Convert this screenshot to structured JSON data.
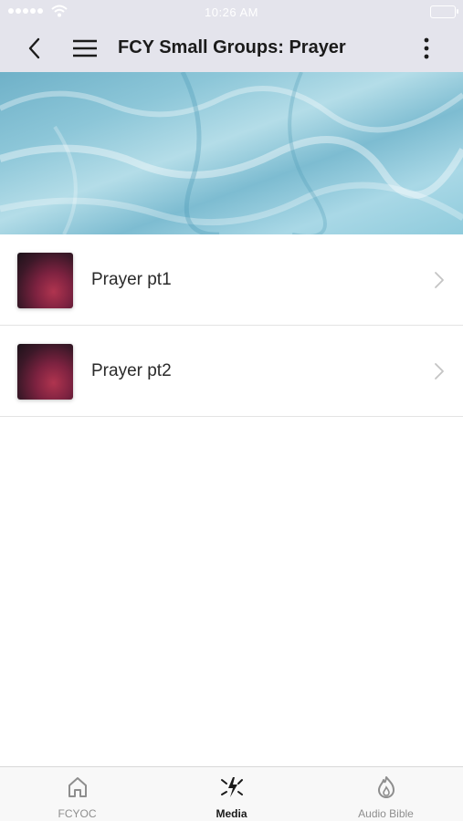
{
  "status_bar": {
    "time": "10:26 AM"
  },
  "nav": {
    "title": "FCY Small Groups: Prayer",
    "back_icon": "chevron-left-icon",
    "menu_icon": "hamburger-menu-icon",
    "more_icon": "more-vertical-icon"
  },
  "list": {
    "items": [
      {
        "label": "Prayer pt1"
      },
      {
        "label": "Prayer pt2"
      }
    ]
  },
  "tabs": [
    {
      "label": "FCYOC",
      "icon": "home-icon",
      "active": false
    },
    {
      "label": "Media",
      "icon": "media-burst-icon",
      "active": true
    },
    {
      "label": "Audio Bible",
      "icon": "flame-icon",
      "active": false
    }
  ],
  "colors": {
    "nav_background": "#e4e4ec",
    "text": "#1b1b1b",
    "inactive_tab": "#8e8e8e"
  }
}
